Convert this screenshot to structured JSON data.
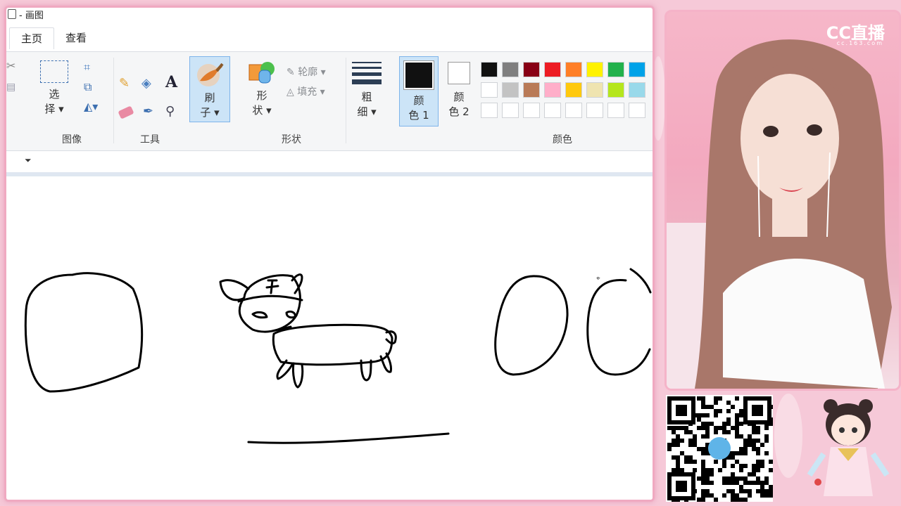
{
  "window": {
    "title": "画图"
  },
  "tabs": [
    {
      "label": "主页"
    },
    {
      "label": "查看"
    }
  ],
  "ribbon": {
    "image_group": {
      "label": "图像",
      "select_line1": "选",
      "select_line2": "择"
    },
    "tools_group": {
      "label": "工具"
    },
    "brush": {
      "line1": "刷",
      "line2": "子"
    },
    "shapes_group": {
      "label": "形状",
      "shape_line1": "形",
      "shape_line2": "状",
      "outline_label": "轮廓",
      "fill_label": "填充"
    },
    "size": {
      "line1": "粗",
      "line2": "细"
    },
    "color1": {
      "line1": "颜",
      "line2": "色 1"
    },
    "color2": {
      "line1": "颜",
      "line2": "色 2"
    },
    "colors_group": {
      "label": "颜色"
    },
    "palette_row1": [
      "#111111",
      "#7f7f7f",
      "#880015",
      "#ed1c24",
      "#ff7f27",
      "#fff200",
      "#22b14c",
      "#00a2e8"
    ],
    "palette_row2": [
      "#ffffff",
      "#c3c3c3",
      "#b97a57",
      "#ffaec9",
      "#ffc90e",
      "#efe4b0",
      "#b5e61d",
      "#99d9ea"
    ]
  },
  "stream": {
    "logo": "CC直播",
    "logo_sub": "cc.163.com"
  }
}
